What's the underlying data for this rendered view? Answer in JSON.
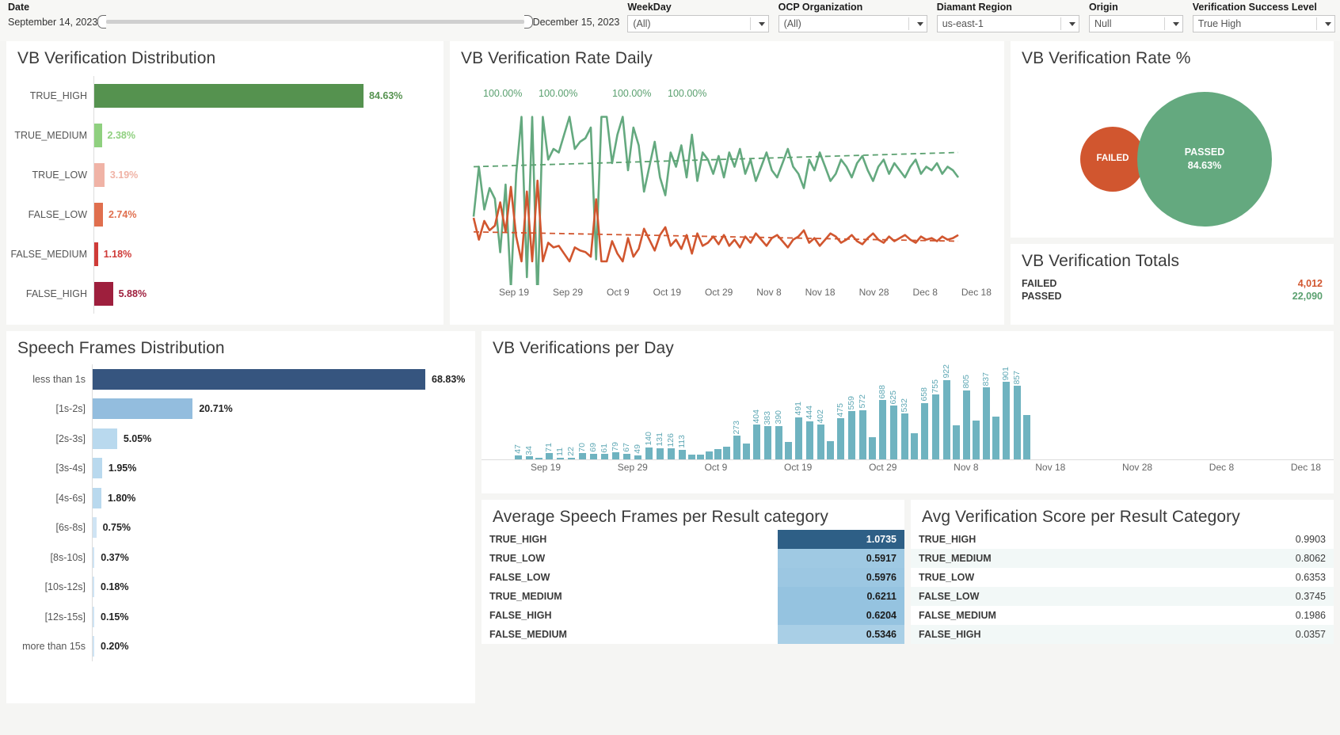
{
  "filters": {
    "date": {
      "label": "Date",
      "start": "September 14, 2023",
      "end": "December 15, 2023"
    },
    "weekday": {
      "label": "WeekDay",
      "value": "(All)"
    },
    "ocp_organization": {
      "label": "OCP Organization",
      "value": "(All)"
    },
    "diamant_region": {
      "label": "Diamant Region",
      "value": "us-east-1"
    },
    "origin": {
      "label": "Origin",
      "value": "Null"
    },
    "verification_success_level": {
      "label": "Verification Success Level",
      "value": "True High"
    }
  },
  "panels": {
    "distribution_title": "VB Verification Distribution",
    "rate_daily_title": "VB Verification Rate Daily",
    "rate_pct_title": "VB Verification Rate %",
    "totals_title": "VB Verification Totals",
    "speech_title": "Speech Frames Distribution",
    "per_day_title": "VB Verifications per Day",
    "avg_speech_title": "Average Speech Frames per Result category",
    "avg_score_title": "Avg Verification Score per Result Category"
  },
  "totals": {
    "rows": [
      {
        "label": "FAILED",
        "value": "4,012",
        "color": "#d1562f"
      },
      {
        "label": "PASSED",
        "value": "22,090",
        "color": "#5aa06f"
      }
    ]
  },
  "rate_circles": {
    "failed_label": "FAILED",
    "passed_label": "PASSED",
    "passed_value": "84.63%",
    "failed_color": "#d1562f",
    "passed_color": "#64a97f"
  },
  "chart_data": [
    {
      "type": "bar",
      "title": "VB Verification Distribution",
      "orientation": "horizontal",
      "categories": [
        "TRUE_HIGH",
        "TRUE_MEDIUM",
        "TRUE_LOW",
        "FALSE_LOW",
        "FALSE_MEDIUM",
        "FALSE_HIGH"
      ],
      "values": [
        84.63,
        2.38,
        3.19,
        2.74,
        1.18,
        5.88
      ],
      "labels": [
        "84.63%",
        "2.38%",
        "3.19%",
        "2.74%",
        "1.18%",
        "5.88%"
      ],
      "colors": [
        "#55924f",
        "#8fd07f",
        "#f0b3a6",
        "#e06f4e",
        "#cf3b38",
        "#9e1f3d"
      ],
      "xlabel": "",
      "ylabel": "",
      "xlim": [
        0,
        84.63
      ],
      "grid": false
    },
    {
      "type": "line",
      "title": "VB Verification Rate Daily",
      "xlabel": "",
      "ylabel": "",
      "ylim": [
        0,
        100
      ],
      "grid": false,
      "annotations": [
        "100.00%",
        "100.00%",
        "100.00%",
        "100.00%"
      ],
      "xticks": [
        "Sep 19",
        "Sep 29",
        "Oct 9",
        "Oct 19",
        "Oct 29",
        "Nov 8",
        "Nov 18",
        "Nov 28",
        "Dec 8",
        "Dec 18"
      ],
      "series": [
        {
          "name": "passed-rate",
          "color": "#64a97f",
          "values": [
            72,
            86,
            74,
            80,
            77,
            62,
            81,
            52,
            84,
            100,
            55,
            100,
            48,
            100,
            88,
            91,
            90,
            95,
            100,
            91,
            93,
            94,
            97,
            60,
            100,
            100,
            87,
            95,
            100,
            85,
            97,
            92,
            79,
            86,
            93,
            83,
            78,
            90,
            86,
            92,
            83,
            95,
            82,
            90,
            88,
            84,
            89,
            83,
            90,
            86,
            91,
            84,
            88,
            82,
            86,
            90,
            85,
            83,
            87,
            91,
            86,
            84,
            80,
            88,
            85,
            90,
            86,
            82,
            84,
            88,
            86,
            83,
            87,
            89,
            85,
            82,
            86,
            88,
            84,
            87,
            85,
            83,
            86,
            88,
            84,
            86,
            85,
            87,
            84,
            86,
            85,
            83
          ]
        },
        {
          "name": "failed-rate",
          "color": "#d1562f",
          "values": [
            28,
            14,
            26,
            20,
            23,
            38,
            19,
            48,
            16,
            0,
            45,
            0,
            52,
            0,
            12,
            9,
            10,
            5,
            0,
            9,
            7,
            6,
            3,
            40,
            0,
            0,
            13,
            5,
            0,
            15,
            3,
            8,
            21,
            14,
            7,
            17,
            22,
            10,
            14,
            8,
            17,
            5,
            18,
            10,
            12,
            16,
            11,
            17,
            10,
            14,
            9,
            16,
            12,
            18,
            14,
            10,
            15,
            17,
            13,
            9,
            14,
            16,
            20,
            12,
            15,
            10,
            14,
            18,
            16,
            12,
            14,
            17,
            13,
            11,
            15,
            18,
            14,
            12,
            16,
            13,
            15,
            17,
            14,
            12,
            16,
            14,
            15,
            13,
            16,
            14,
            15,
            17
          ]
        },
        {
          "name": "passed-trend",
          "color": "#5aa06f",
          "style": "dashed",
          "values": [
            84,
            88
          ]
        },
        {
          "name": "failed-trend",
          "color": "#d1562f",
          "style": "dashed",
          "values": [
            16,
            12
          ]
        }
      ]
    },
    {
      "type": "bar",
      "title": "Speech Frames Distribution",
      "orientation": "horizontal",
      "categories": [
        "less than 1s",
        "[1s-2s]",
        "[2s-3s]",
        "[3s-4s]",
        "[4s-6s]",
        "[6s-8s]",
        "[8s-10s]",
        "[10s-12s]",
        "[12s-15s]",
        "more than 15s"
      ],
      "values": [
        68.83,
        20.71,
        5.05,
        1.95,
        1.8,
        0.75,
        0.37,
        0.18,
        0.15,
        0.2
      ],
      "labels": [
        "68.83%",
        "20.71%",
        "5.05%",
        "1.95%",
        "1.80%",
        "0.75%",
        "0.37%",
        "0.18%",
        "0.15%",
        "0.20%"
      ],
      "xlabel": "",
      "ylabel": "",
      "xlim": [
        0,
        68.83
      ],
      "grid": false
    },
    {
      "type": "bar",
      "title": "VB Verifications per Day",
      "orientation": "vertical",
      "color": "#6fb3c0",
      "xticks": [
        "Sep 19",
        "Sep 29",
        "Oct 9",
        "Oct 19",
        "Oct 29",
        "Nov 8",
        "Nov 18",
        "Nov 28",
        "Dec 8",
        "Dec 18"
      ],
      "ylim": [
        0,
        922
      ],
      "grid": false,
      "values": [
        47,
        34,
        9,
        71,
        11,
        22,
        70,
        69,
        61,
        79,
        67,
        49,
        140,
        131,
        126,
        113,
        60,
        55,
        90,
        120,
        150,
        273,
        180,
        404,
        383,
        390,
        200,
        491,
        444,
        402,
        210,
        475,
        559,
        572,
        260,
        688,
        625,
        532,
        300,
        658,
        755,
        922,
        400,
        805,
        450,
        837,
        500,
        901,
        857,
        520
      ],
      "labels": [
        "47",
        "34",
        "",
        "71",
        "11",
        "22",
        "70",
        "69",
        "61",
        "79",
        "67",
        "49",
        "140",
        "131",
        "126",
        "113",
        "",
        "",
        "",
        "",
        "",
        "273",
        "",
        "404",
        "383",
        "390",
        "",
        "491",
        "444",
        "402",
        "",
        "475",
        "559",
        "572",
        "",
        "688",
        "625",
        "532",
        "",
        "658",
        "755",
        "922",
        "",
        "805",
        "",
        "837",
        "",
        "901",
        "857",
        ""
      ]
    },
    {
      "type": "table",
      "title": "Average Speech Frames per Result category",
      "columns": [
        "category",
        "value"
      ],
      "rows": [
        {
          "category": "TRUE_HIGH",
          "value": "1.0735",
          "bg": "#2e5f86",
          "fg": "#ffffff"
        },
        {
          "category": "TRUE_LOW",
          "value": "0.5917",
          "bg": "#9fc9e3",
          "fg": "#1b1b1b"
        },
        {
          "category": "FALSE_LOW",
          "value": "0.5976",
          "bg": "#9cc7e2",
          "fg": "#1b1b1b"
        },
        {
          "category": "TRUE_MEDIUM",
          "value": "0.6211",
          "bg": "#95c3e0",
          "fg": "#1b1b1b"
        },
        {
          "category": "FALSE_HIGH",
          "value": "0.6204",
          "bg": "#95c3e0",
          "fg": "#1b1b1b"
        },
        {
          "category": "FALSE_MEDIUM",
          "value": "0.5346",
          "bg": "#a9cfe6",
          "fg": "#1b1b1b"
        }
      ]
    },
    {
      "type": "table",
      "title": "Avg Verification Score per Result Category",
      "columns": [
        "category",
        "value"
      ],
      "rows": [
        {
          "category": "TRUE_HIGH",
          "value": "0.9903"
        },
        {
          "category": "TRUE_MEDIUM",
          "value": "0.8062"
        },
        {
          "category": "TRUE_LOW",
          "value": "0.6353"
        },
        {
          "category": "FALSE_LOW",
          "value": "0.3745"
        },
        {
          "category": "FALSE_MEDIUM",
          "value": "0.1986"
        },
        {
          "category": "FALSE_HIGH",
          "value": "0.0357"
        }
      ]
    }
  ]
}
